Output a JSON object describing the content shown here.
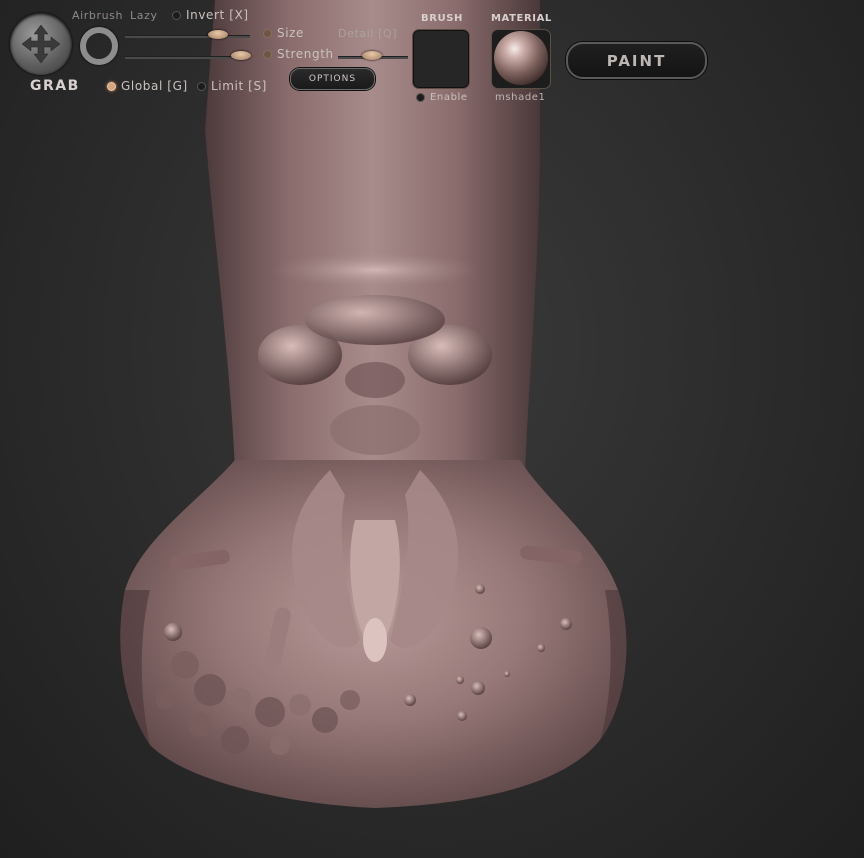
{
  "toolbar": {
    "tool_name": "GRAB",
    "airbrush_label": "Airbrush",
    "lazy_label": "Lazy",
    "invert_label": "Invert [X]",
    "size_label": "Size",
    "detail_label": "Detail [Q]",
    "strength_label": "Strength",
    "options_label": "OPTIONS",
    "global_label": "Global [G]",
    "limit_label": "Limit [S]",
    "brush_heading": "BRUSH",
    "enable_label": "Enable",
    "material_heading": "MATERIAL",
    "material_name": "mshade1",
    "paint_label": "PAINT"
  },
  "icons": {
    "tool": "move-arrows-icon",
    "stroke": "ring-icon"
  },
  "colors": {
    "accent": "#d6a57e",
    "model_base": "#8f7070",
    "background": "#2a2a2a"
  }
}
